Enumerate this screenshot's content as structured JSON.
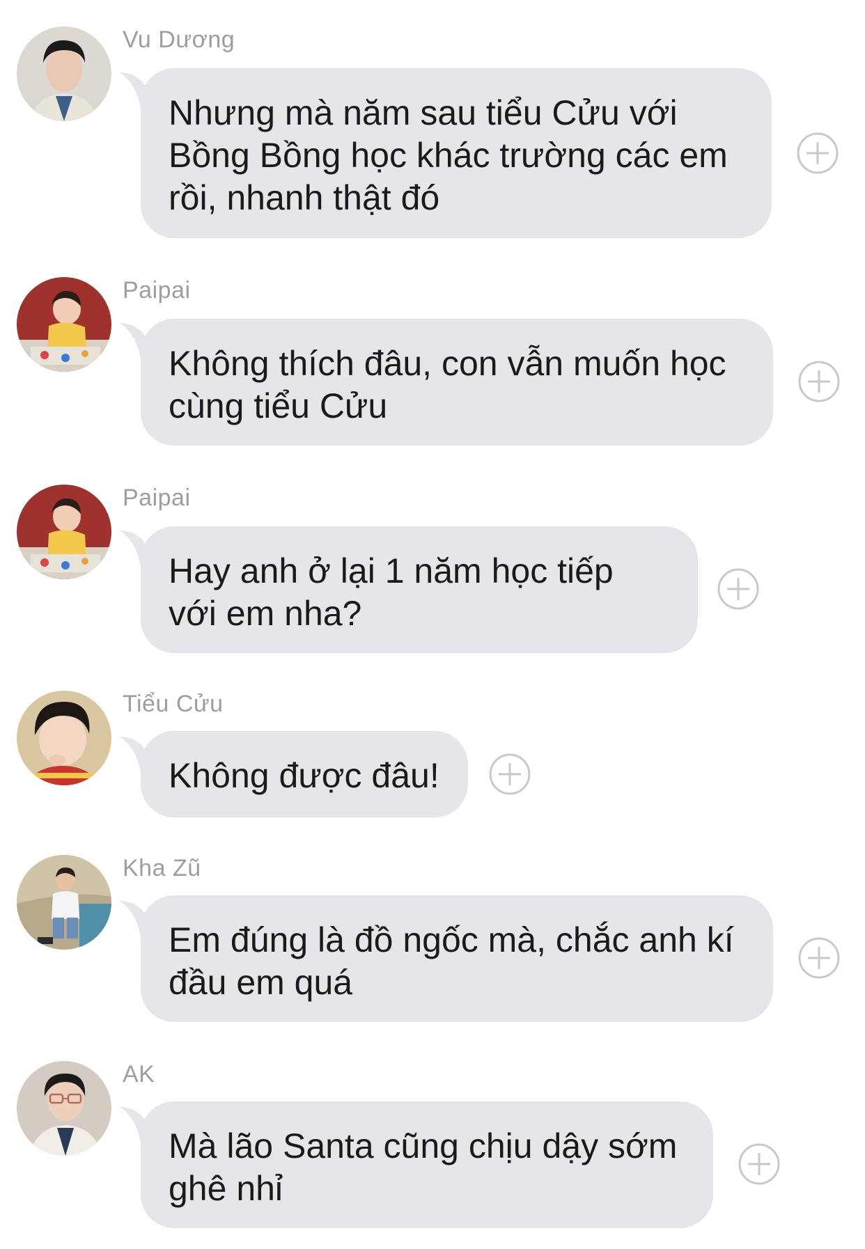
{
  "messages": [
    {
      "sender": "Vu Dương",
      "text": "Nhưng mà năm sau tiểu Cửu với Bồng Bồng học khác trường các em rồi, nhanh thật đó",
      "avatar_icon": "avatar-man-glasses-free"
    },
    {
      "sender": "Paipai",
      "text": "Không thích đâu, con vẫn muốn học cùng tiểu Cửu",
      "avatar_icon": "avatar-child-painting"
    },
    {
      "sender": "Paipai",
      "text": "Hay anh ở lại 1 năm học tiếp với em nha?",
      "avatar_icon": "avatar-child-painting"
    },
    {
      "sender": "Tiểu Cửu",
      "text": "Không được đâu!",
      "avatar_icon": "avatar-child-thinking"
    },
    {
      "sender": "Kha Zũ",
      "text": "Em đúng là đồ ngốc mà, chắc anh kí đầu em quá",
      "avatar_icon": "avatar-child-poolside"
    },
    {
      "sender": "AK",
      "text": "Mà lão Santa cũng chịu dậy sớm ghê nhỉ",
      "avatar_icon": "avatar-man-glasses"
    }
  ],
  "colors": {
    "bubble": "#e5e6ea",
    "sender": "#9b9ea3",
    "plus": "#c8c9cc"
  },
  "icons": {
    "reaction": "plus-circle-icon"
  }
}
